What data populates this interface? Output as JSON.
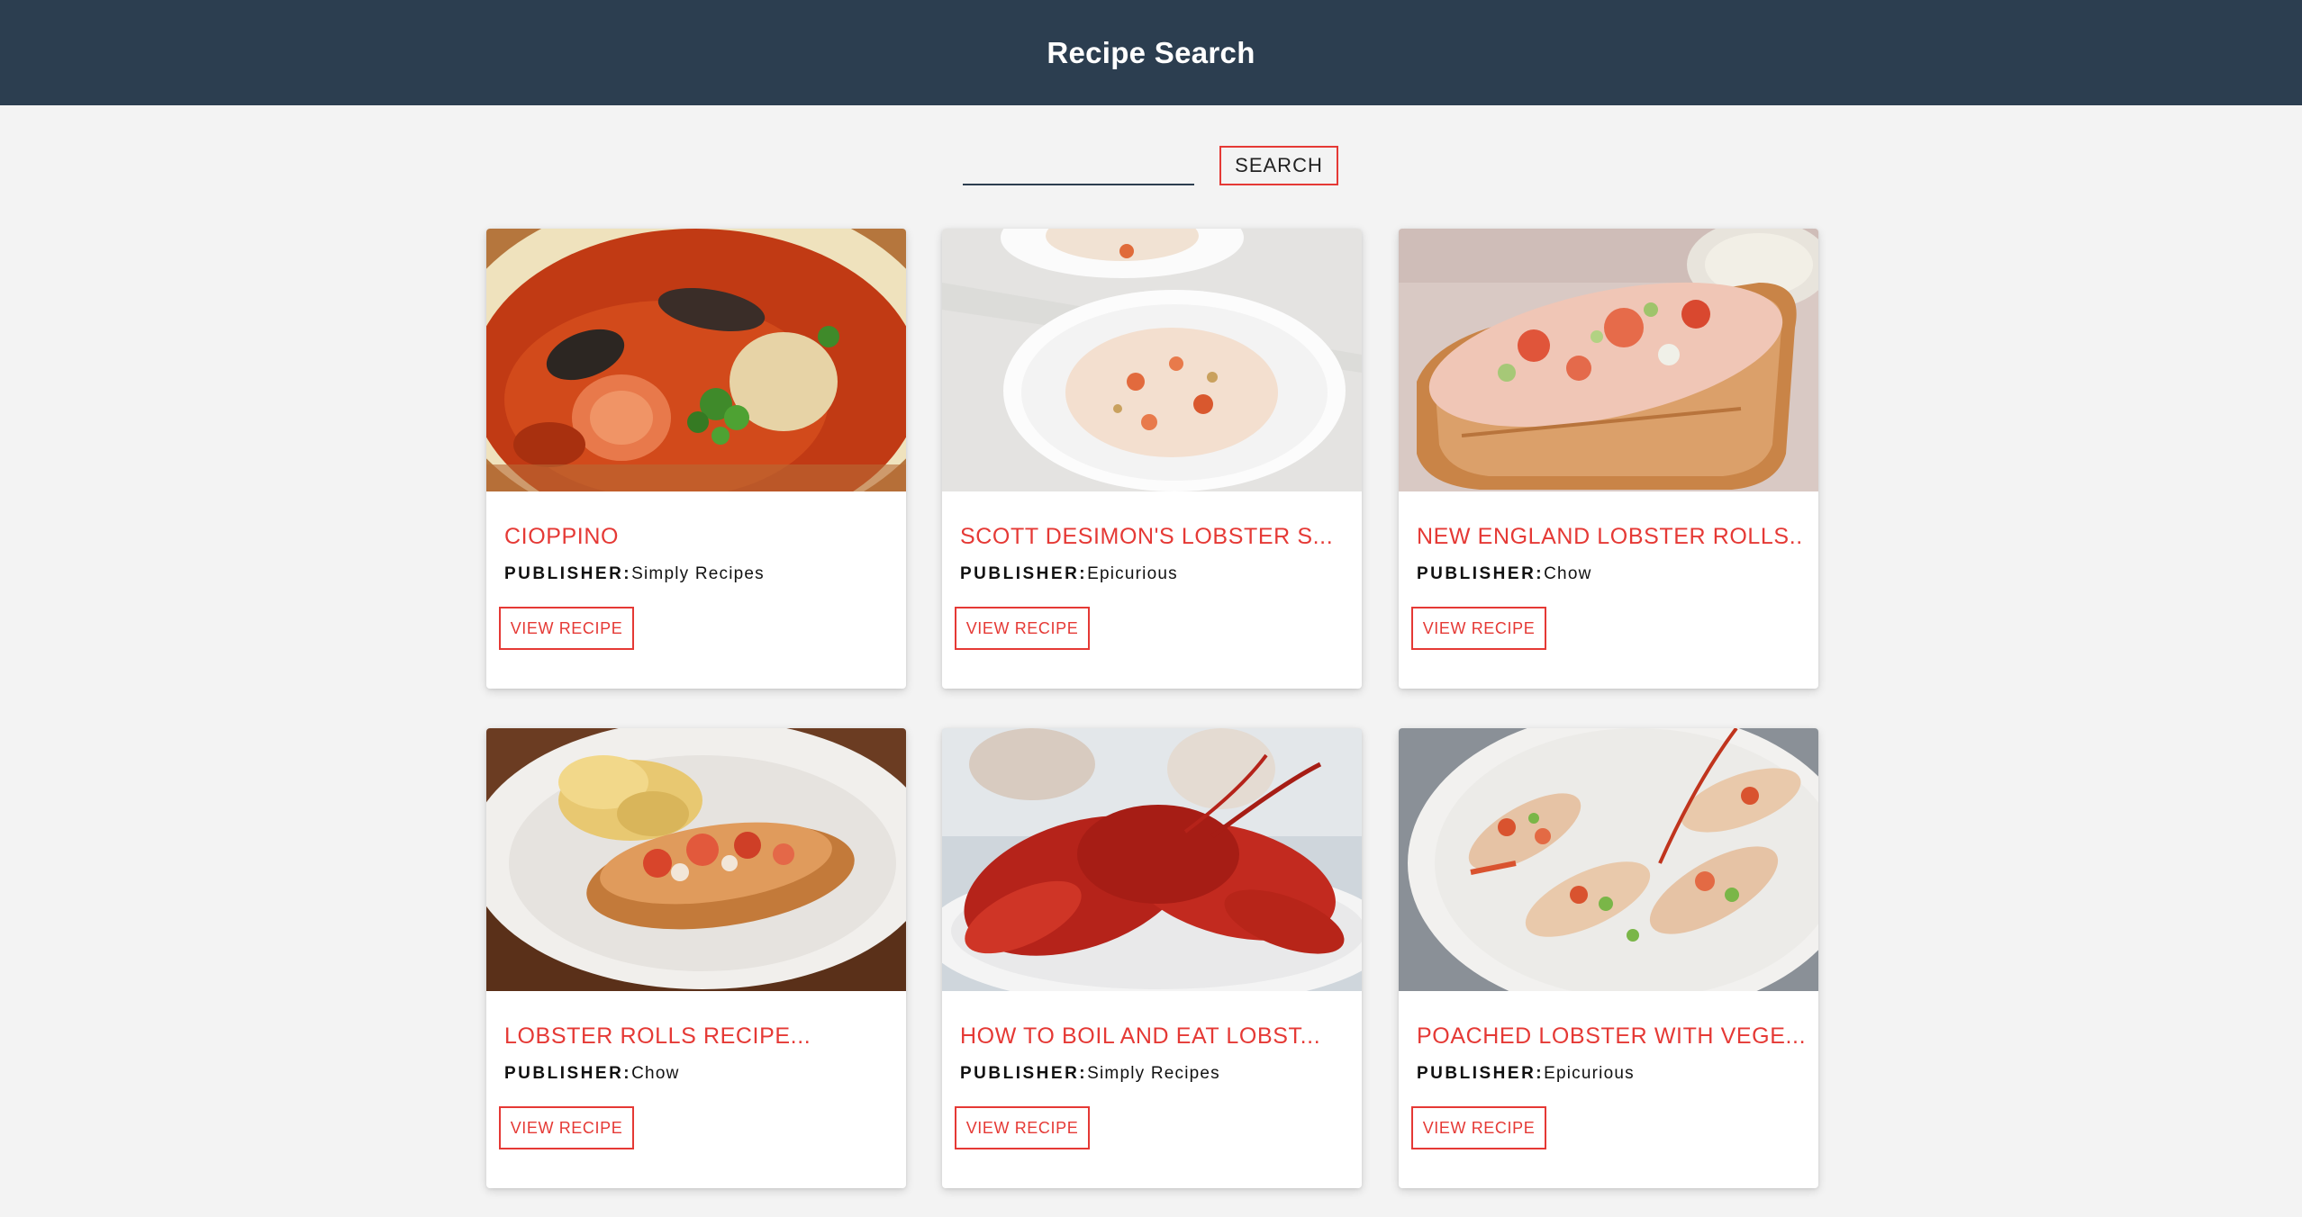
{
  "header": {
    "title": "Recipe Search"
  },
  "search": {
    "query": "",
    "placeholder": "",
    "button_label": "SEARCH"
  },
  "publisher_label": "PUBLISHER:",
  "recipes": [
    {
      "title": "CIOPPINO",
      "publisher": "Simply Recipes",
      "button_label": "VIEW RECIPE",
      "image": "cioppino-seafood-stew-photo"
    },
    {
      "title": "SCOTT DESIMON'S LOBSTER S...",
      "publisher": "Epicurious",
      "button_label": "VIEW RECIPE",
      "image": "lobster-bisque-bowls-photo"
    },
    {
      "title": "NEW ENGLAND LOBSTER ROLLS...",
      "publisher": "Chow",
      "button_label": "VIEW RECIPE",
      "image": "lobster-roll-photo"
    },
    {
      "title": "LOBSTER ROLLS RECIPE...",
      "publisher": "Chow",
      "button_label": "VIEW RECIPE",
      "image": "lobster-roll-basket-photo"
    },
    {
      "title": "HOW TO BOIL AND EAT LOBST...",
      "publisher": "Simply Recipes",
      "button_label": "VIEW RECIPE",
      "image": "boiled-lobster-platter-photo"
    },
    {
      "title": "POACHED LOBSTER WITH VEGE...",
      "publisher": "Epicurious",
      "button_label": "VIEW RECIPE",
      "image": "poached-lobster-plate-photo"
    }
  ],
  "colors": {
    "header_bg": "#2c3e50",
    "accent": "#e53935",
    "page_bg": "#f3f3f3"
  }
}
